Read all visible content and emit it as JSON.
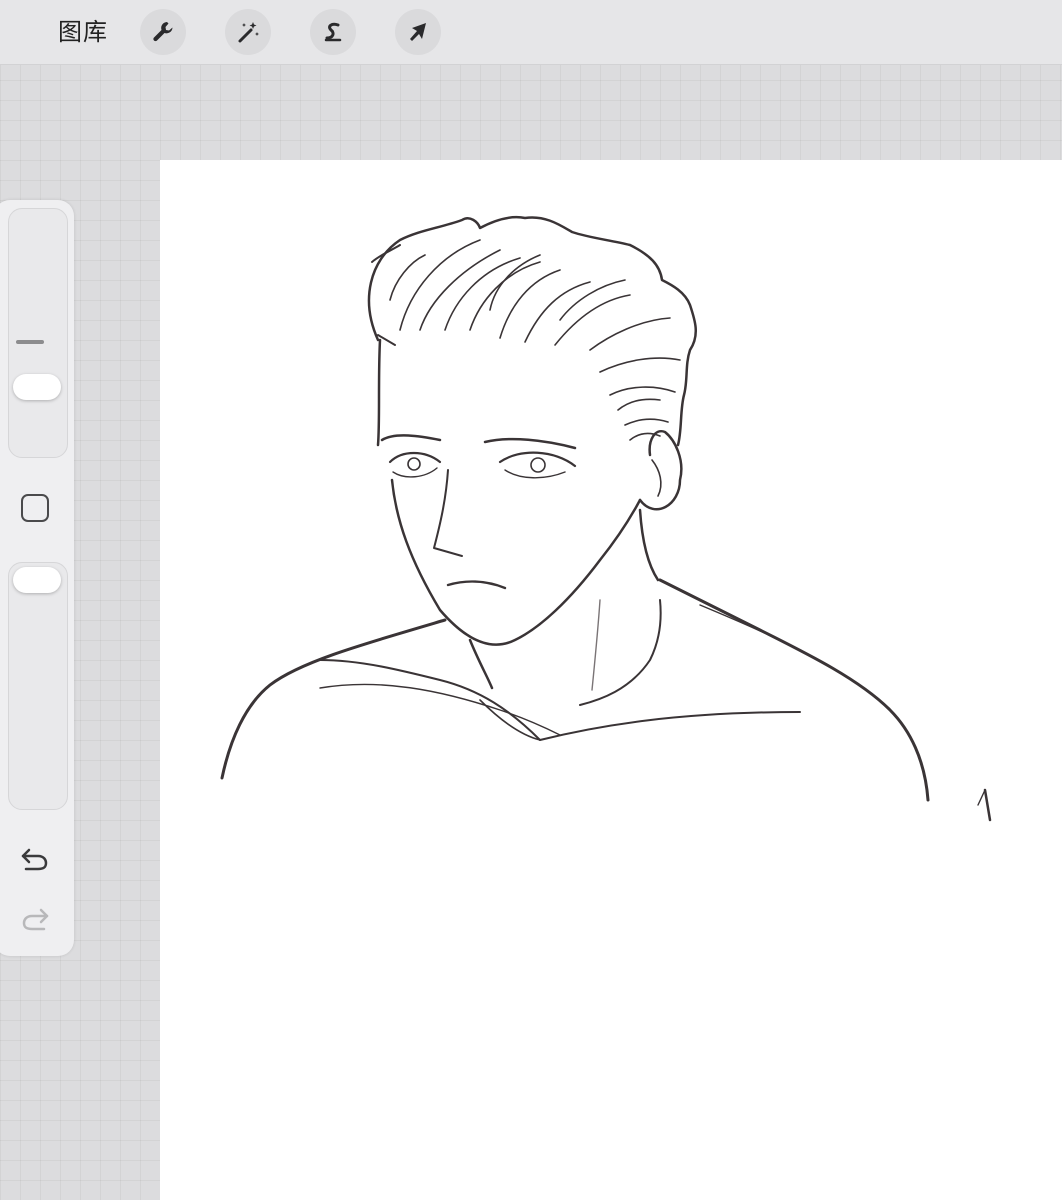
{
  "topbar": {
    "gallery_label": "图库",
    "tools": [
      {
        "icon": "wrench-icon",
        "name": "actions"
      },
      {
        "icon": "magic-wand-icon",
        "name": "adjustments"
      },
      {
        "icon": "selection-s-icon",
        "name": "selection"
      },
      {
        "icon": "arrow-cursor-icon",
        "name": "transform"
      }
    ]
  },
  "sidebar": {
    "brush_size_slider": {
      "value": 0.25
    },
    "opacity_slider": {
      "value": 1.0
    },
    "modify_button_icon": "square-icon",
    "undo_icon": "undo-icon",
    "redo_icon": "redo-icon"
  },
  "canvas": {
    "content": "line-art-sketch",
    "background": "#ffffff"
  },
  "colors": {
    "toolbar_bg": "#e6e6e8",
    "workspace_bg": "#dcdcde",
    "stroke": "#3a3436"
  }
}
